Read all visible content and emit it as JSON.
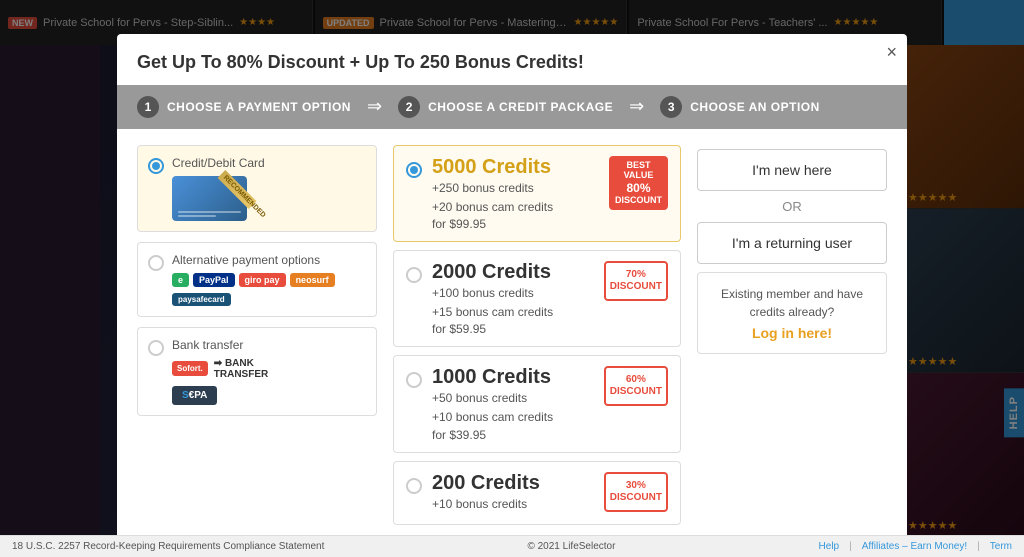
{
  "top_bar": {
    "items": [
      {
        "badge": "NEW",
        "badge_type": "new",
        "title": "Private School for Pervs - Step-Siblin...",
        "stars": "★★★★"
      },
      {
        "badge": "UPDATED",
        "badge_type": "updated",
        "title": "Private School for Pervs - Mastering ...",
        "stars": "★★★★★"
      },
      {
        "badge": "",
        "badge_type": "",
        "title": "Private School For Pervs - Teachers' ...",
        "stars": "★★★★★"
      }
    ]
  },
  "modal": {
    "close_label": "×",
    "header": "Get Up To 80% Discount + Up To 250 Bonus Credits!",
    "steps": [
      {
        "num": "1",
        "label": "CHOOSE A PAYMENT OPTION"
      },
      {
        "num": "2",
        "label": "CHOOSE A CREDIT PACKAGE"
      },
      {
        "num": "3",
        "label": "CHOOSE AN OPTION"
      }
    ]
  },
  "payment_options": {
    "title": "Credit/Debit Card",
    "recommended": "RECOMMENDED",
    "alt_title": "Alternative payment options",
    "logos": [
      "e",
      "PayPal",
      "giro pay",
      "neosurf",
      "paysafecard"
    ],
    "bank_title": "Bank transfer",
    "bank_logos": [
      "Sofort.",
      "BANK TRANSFER"
    ],
    "sepa": "SEPA"
  },
  "credit_packages": [
    {
      "id": "pkg5000",
      "credits": "5000 Credits",
      "color": "gold",
      "bonus1": "+250 bonus credits",
      "bonus2": "+20 bonus cam credits",
      "price": "for $99.95",
      "badge_type": "best-value",
      "badge_line1": "BEST",
      "badge_line2": "VALUE",
      "badge_disc": "80%",
      "badge_label": "DISCOUNT",
      "selected": true
    },
    {
      "id": "pkg2000",
      "credits": "2000 Credits",
      "color": "dark",
      "bonus1": "+100 bonus credits",
      "bonus2": "+15 bonus cam credits",
      "price": "for $59.95",
      "badge_type": "discount",
      "badge_disc": "70%",
      "badge_label": "DISCOUNT",
      "selected": false
    },
    {
      "id": "pkg1000",
      "credits": "1000 Credits",
      "color": "dark",
      "bonus1": "+50 bonus credits",
      "bonus2": "+10 bonus cam credits",
      "price": "for $39.95",
      "badge_type": "discount",
      "badge_disc": "60%",
      "badge_label": "DISCOUNT",
      "selected": false
    },
    {
      "id": "pkg200",
      "credits": "200 Credits",
      "color": "dark",
      "bonus1": "+10 bonus credits",
      "bonus2": "",
      "price": "",
      "badge_type": "discount",
      "badge_disc": "30%",
      "badge_label": "DISCOUNT",
      "selected": false
    }
  ],
  "user_options": {
    "new_user_label": "I'm new here",
    "or_label": "OR",
    "returning_user_label": "I'm a returning user",
    "existing_text": "Existing member and have credits already?",
    "login_label": "Log in here!"
  },
  "bottom_bar": {
    "compliance": "18 U.S.C. 2257 Record-Keeping Requirements Compliance Statement",
    "copyright": "© 2021 LifeSelector",
    "links": [
      "Help",
      "Affiliates – Earn Money!",
      "Term"
    ]
  }
}
